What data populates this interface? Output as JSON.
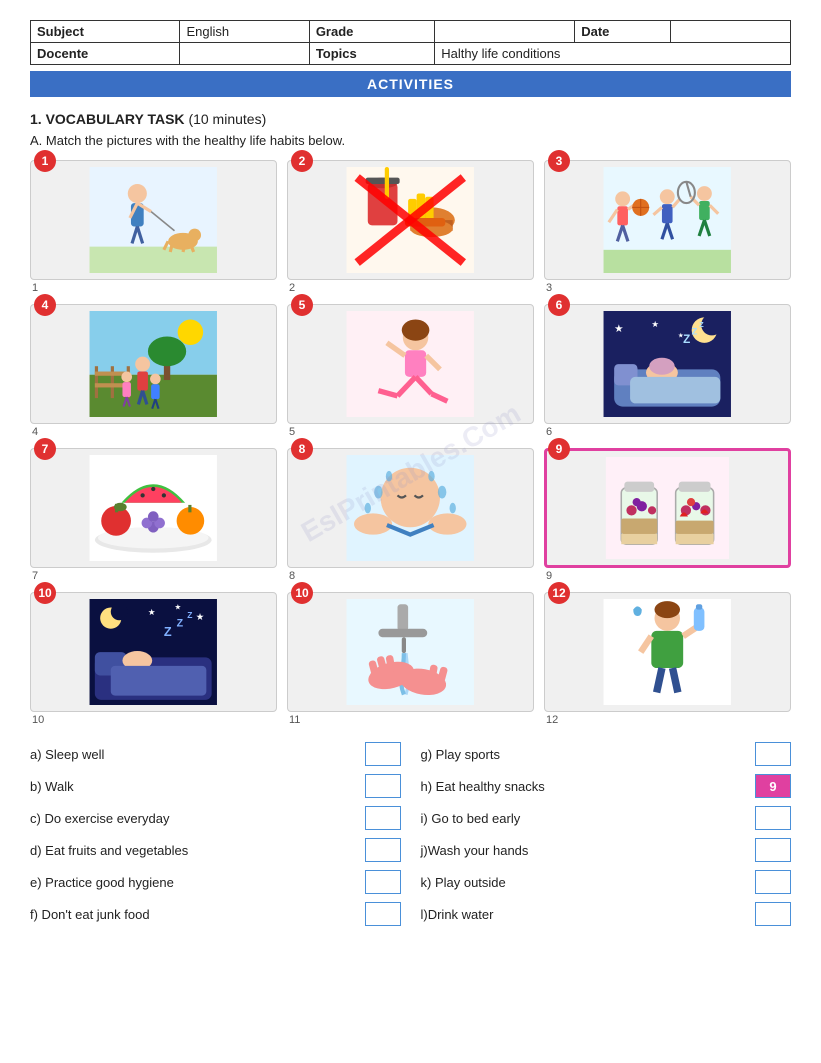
{
  "header": {
    "subject_label": "Subject",
    "subject_value": "English",
    "grade_label": "Grade",
    "grade_value": "",
    "date_label": "Date",
    "date_value": "",
    "docente_label": "Docente",
    "docente_value": "",
    "topics_label": "Topics",
    "topics_value": "Halthy life conditions"
  },
  "banner": "ACTIVITIES",
  "section1": {
    "number": "1.",
    "title": "VOCABULARY TASK",
    "subtitle": "(10 minutes)"
  },
  "instruction_a": "A. Match the pictures with the healthy life habits below.",
  "images": [
    {
      "id": 1,
      "label": "1",
      "desc": "person walking dog",
      "pink": false
    },
    {
      "id": 2,
      "label": "2",
      "desc": "junk food crossed out",
      "pink": false
    },
    {
      "id": 3,
      "label": "3",
      "desc": "kids playing sports",
      "pink": false
    },
    {
      "id": 4,
      "label": "4",
      "desc": "family outside",
      "pink": false
    },
    {
      "id": 5,
      "label": "5",
      "desc": "girl exercising",
      "pink": false
    },
    {
      "id": 6,
      "label": "6",
      "desc": "sleeping / zzz",
      "pink": false
    },
    {
      "id": 7,
      "label": "7",
      "desc": "fruits and vegetables",
      "pink": false
    },
    {
      "id": 8,
      "label": "8",
      "desc": "washing face / hygiene",
      "pink": false
    },
    {
      "id": 9,
      "label": "9",
      "desc": "healthy snacks jars",
      "pink": true
    },
    {
      "id": 10,
      "label": "10",
      "desc": "sleeping at night",
      "pink": false
    },
    {
      "id": 10,
      "label": "11",
      "desc": "washing hands",
      "pink": false
    },
    {
      "id": 12,
      "label": "12",
      "desc": "drinking water",
      "pink": false
    }
  ],
  "matching": {
    "left": [
      {
        "key": "a)",
        "label": "Sleep well"
      },
      {
        "key": "b)",
        "label": "Walk"
      },
      {
        "key": "c)",
        "label": "Do exercise everyday"
      },
      {
        "key": "d)",
        "label": "Eat fruits and vegetables"
      },
      {
        "key": "e)",
        "label": "Practice good hygiene"
      },
      {
        "key": "f)",
        "label": "Don't eat junk food"
      }
    ],
    "right": [
      {
        "key": "g)",
        "label": "Play sports",
        "filled": false
      },
      {
        "key": "h)",
        "label": "Eat healthy snacks",
        "filled": true,
        "value": "9"
      },
      {
        "key": "i)",
        "label": "Go to bed early",
        "filled": false
      },
      {
        "key": "j)",
        "label": "Wash your hands",
        "filled": false
      },
      {
        "key": "k)",
        "label": "Play outside",
        "filled": false
      },
      {
        "key": "l)",
        "label": "Drink water",
        "filled": false
      }
    ]
  }
}
